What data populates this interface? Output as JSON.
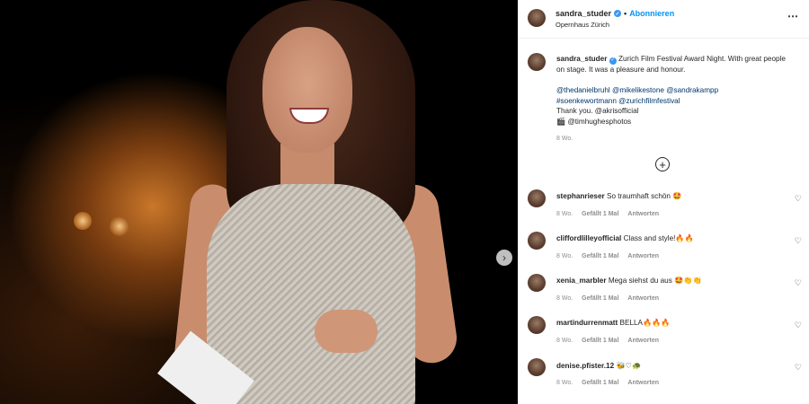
{
  "header": {
    "username": "sandra_studer",
    "dot": "•",
    "follow_label": "Abonnieren",
    "location": "Opernhaus Zürich",
    "more_icon": "⋯"
  },
  "caption": {
    "username": "sandra_studer",
    "text": "Zurich Film Festival Award Night. With great people on stage. It was a pleasure and honour.",
    "mentions_line1": "@thedanielbruhl @mikelikestone @sandrakampp",
    "mentions_line2": "#soenkewortmann @zurichfilmfestival",
    "thanks": "Thank you. @akrisofficial",
    "photo_credit": "🎬 @timhughesphotos",
    "time": "8 Wo."
  },
  "load_more_icon": "+",
  "comments": [
    {
      "user": "stephanrieser",
      "text": "So traumhaft schön 🤩",
      "time": "8 Wo.",
      "likes": "Gefällt 1 Mal",
      "reply": "Antworten"
    },
    {
      "user": "cliffordlilleyofficial",
      "text": "Class and style!🔥🔥",
      "time": "8 Wo.",
      "likes": "Gefällt 1 Mal",
      "reply": "Antworten"
    },
    {
      "user": "xenia_marbler",
      "text": "Mega siehst du aus 🤩👏👏",
      "time": "8 Wo.",
      "likes": "Gefällt 1 Mal",
      "reply": "Antworten"
    },
    {
      "user": "martindurrenmatt",
      "text": "BELLA🔥🔥🔥",
      "time": "8 Wo.",
      "likes": "Gefällt 1 Mal",
      "reply": "Antworten"
    },
    {
      "user": "denise.pfister.12",
      "text": "🐝♡🐢",
      "time": "8 Wo.",
      "likes": "Gefällt 1 Mal",
      "reply": "Antworten"
    }
  ],
  "next_icon": "›",
  "colors": {
    "accent": "#0095f6",
    "muted": "#8e8e8e",
    "text": "#262626"
  }
}
